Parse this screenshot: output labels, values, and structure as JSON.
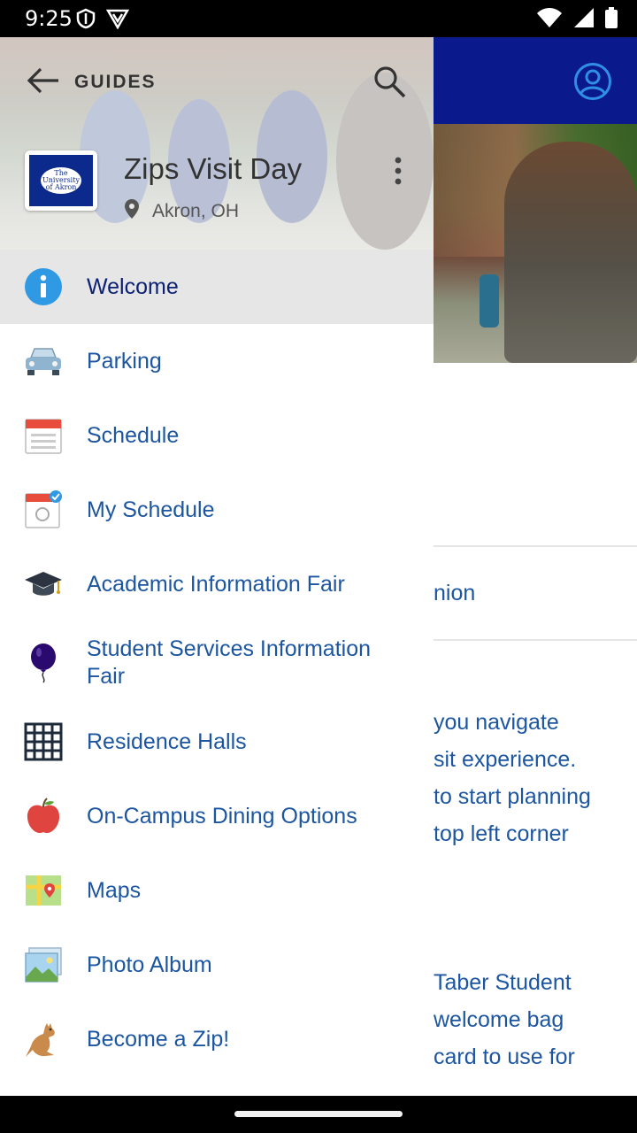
{
  "status_bar": {
    "time": "9:25",
    "icons_left": [
      "shield-icon",
      "vpn-icon"
    ],
    "icons_right": [
      "wifi-icon",
      "cellular-icon",
      "battery-icon"
    ]
  },
  "background": {
    "header_color": "#0a1a8c",
    "section_title_fragment": "nion",
    "paragraph_1": [
      "you navigate",
      "sit experience.",
      "to start planning",
      "top left corner"
    ],
    "paragraph_2": [
      "Taber Student",
      "welcome bag",
      "card to use for"
    ]
  },
  "drawer": {
    "header": {
      "back_label": "GUIDES",
      "guide_title": "Zips Visit Day",
      "location": "Akron, OH",
      "logo_text": "The University of Akron"
    },
    "menu": [
      {
        "label": "Welcome",
        "icon": "info-icon",
        "selected": true
      },
      {
        "label": "Parking",
        "icon": "car-icon",
        "selected": false
      },
      {
        "label": "Schedule",
        "icon": "calendar-icon",
        "selected": false
      },
      {
        "label": "My Schedule",
        "icon": "my-calendar-icon",
        "selected": false
      },
      {
        "label": "Academic Information Fair",
        "icon": "graduation-cap-icon",
        "selected": false
      },
      {
        "label": "Student Services Information Fair",
        "icon": "balloon-icon",
        "selected": false
      },
      {
        "label": "Residence Halls",
        "icon": "building-icon",
        "selected": false
      },
      {
        "label": "On-Campus Dining Options",
        "icon": "apple-icon",
        "selected": false
      },
      {
        "label": "Maps",
        "icon": "map-icon",
        "selected": false
      },
      {
        "label": "Photo Album",
        "icon": "photo-icon",
        "selected": false
      },
      {
        "label": "Become a Zip!",
        "icon": "kangaroo-icon",
        "selected": false
      }
    ]
  }
}
